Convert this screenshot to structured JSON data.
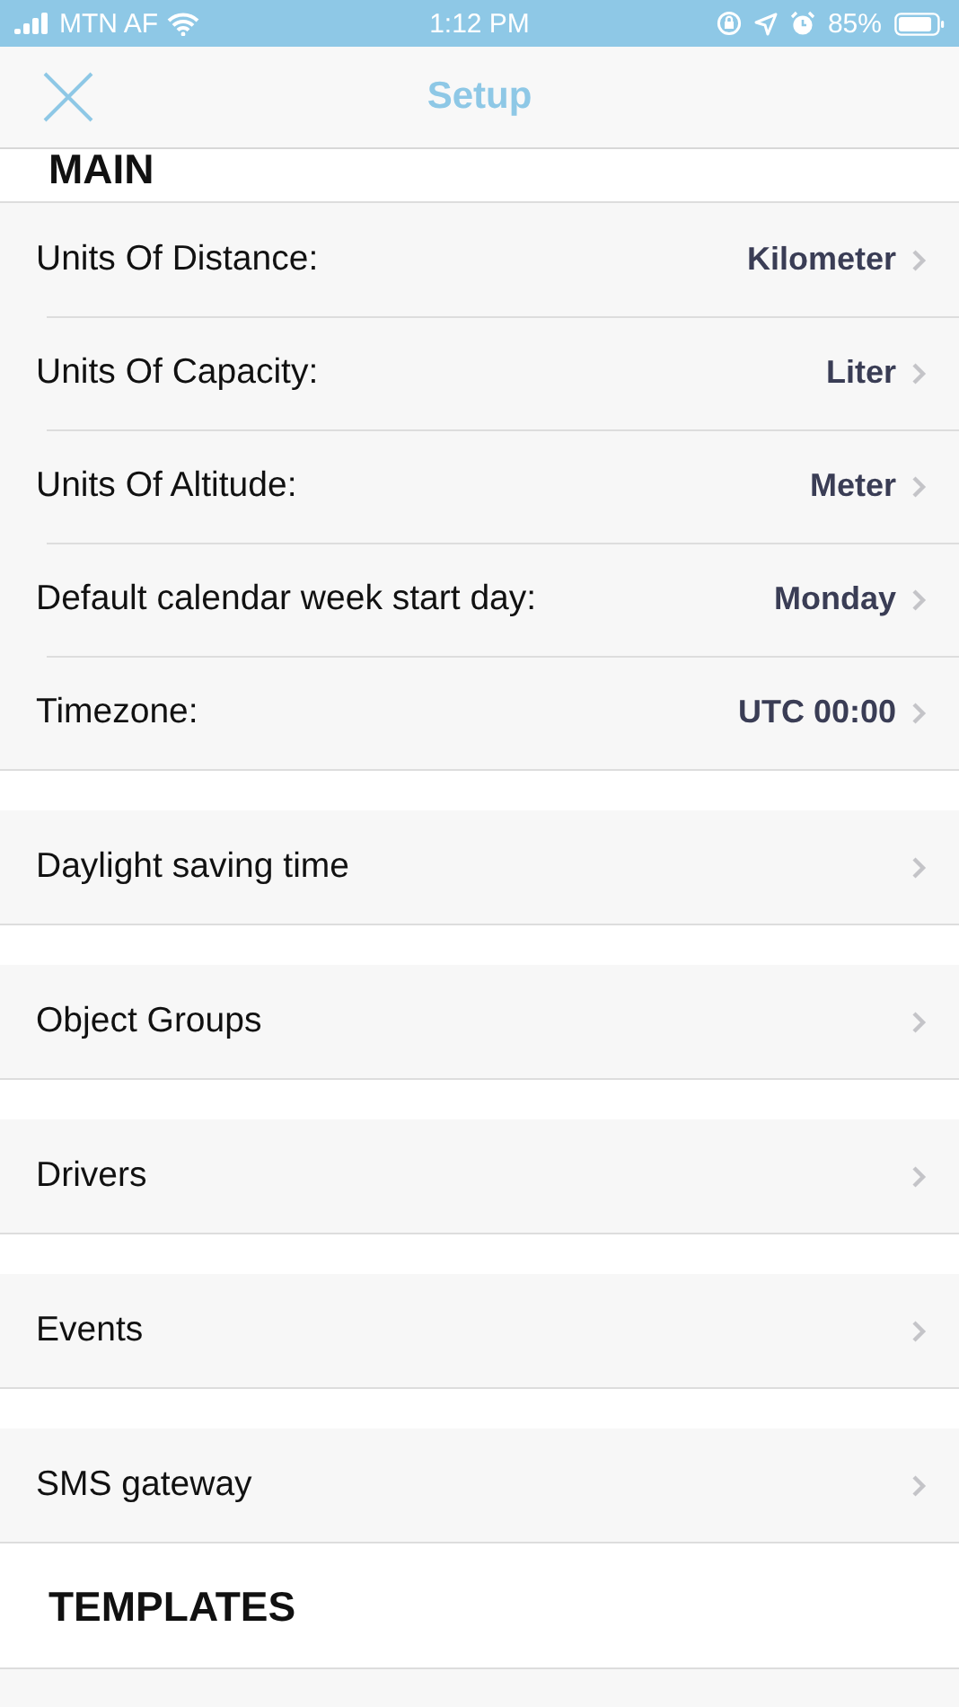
{
  "status_bar": {
    "carrier": "MTN AF",
    "time": "1:12 PM",
    "battery": "85%"
  },
  "header": {
    "title": "Setup"
  },
  "sections": [
    {
      "title": "MAIN",
      "groups": [
        [
          {
            "label": "Units Of Distance:",
            "value": "Kilometer"
          },
          {
            "label": "Units Of Capacity:",
            "value": "Liter"
          },
          {
            "label": "Units Of Altitude:",
            "value": "Meter"
          },
          {
            "label": "Default calendar week start day:",
            "value": "Monday"
          },
          {
            "label": "Timezone:",
            "value": "UTC 00:00"
          }
        ],
        [
          {
            "label": "Daylight saving time"
          }
        ],
        [
          {
            "label": "Object Groups"
          }
        ],
        [
          {
            "label": "Drivers"
          }
        ],
        [
          {
            "label": "Events"
          }
        ],
        [
          {
            "label": "SMS gateway"
          }
        ]
      ]
    },
    {
      "title": "TEMPLATES"
    }
  ]
}
